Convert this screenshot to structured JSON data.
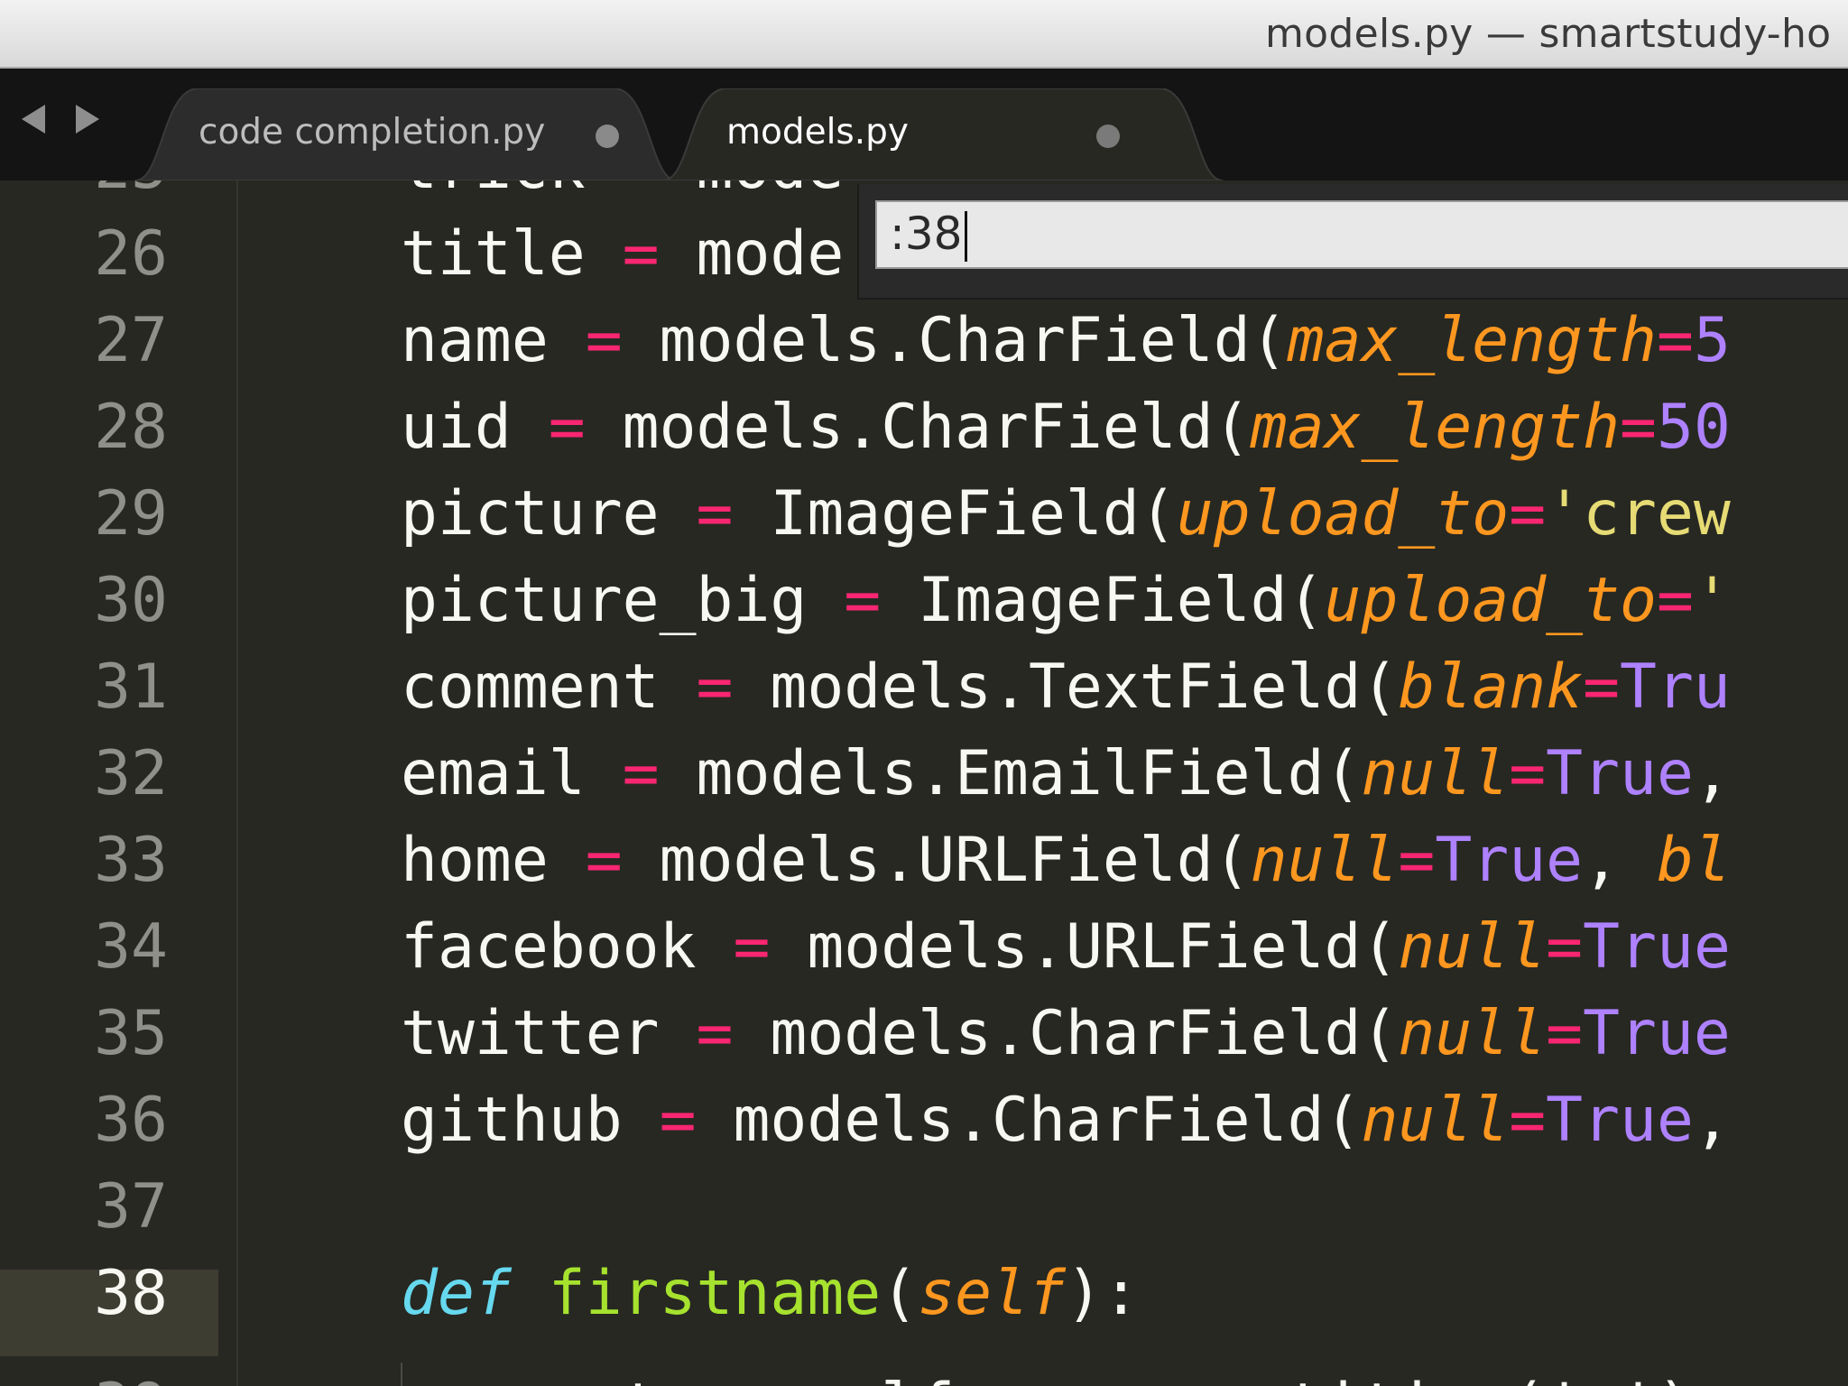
{
  "window": {
    "title": "models.py — smartstudy-ho"
  },
  "nav": {
    "back_icon": "chevron-left-icon",
    "forward_icon": "chevron-right-icon"
  },
  "tabs": [
    {
      "label": "code completion.py",
      "active": false,
      "modified": true
    },
    {
      "label": "models.py",
      "active": true,
      "modified": true
    }
  ],
  "goto": {
    "value": ":38"
  },
  "colors": {
    "background": "#272822",
    "operator": "#f92672",
    "argument": "#fd971f",
    "constant": "#ae81ff",
    "string": "#e6db74",
    "keyword": "#66d9ef",
    "function": "#a6e22e"
  },
  "editor": {
    "current_line": "38",
    "lines": [
      {
        "num": "26",
        "tokens": [
          {
            "t": "title ",
            "c": ""
          },
          {
            "t": "=",
            "c": "op"
          },
          {
            "t": " mode",
            "c": ""
          }
        ]
      },
      {
        "num": "27",
        "tokens": [
          {
            "t": "name ",
            "c": ""
          },
          {
            "t": "=",
            "c": "op"
          },
          {
            "t": " models.CharField(",
            "c": ""
          },
          {
            "t": "max_length",
            "c": "arg"
          },
          {
            "t": "=",
            "c": "op"
          },
          {
            "t": "5",
            "c": "num"
          }
        ]
      },
      {
        "num": "28",
        "tokens": [
          {
            "t": "uid ",
            "c": ""
          },
          {
            "t": "=",
            "c": "op"
          },
          {
            "t": " models.CharField(",
            "c": ""
          },
          {
            "t": "max_length",
            "c": "arg"
          },
          {
            "t": "=",
            "c": "op"
          },
          {
            "t": "50",
            "c": "num"
          }
        ]
      },
      {
        "num": "29",
        "tokens": [
          {
            "t": "picture ",
            "c": ""
          },
          {
            "t": "=",
            "c": "op"
          },
          {
            "t": " ImageField(",
            "c": ""
          },
          {
            "t": "upload_to",
            "c": "arg"
          },
          {
            "t": "=",
            "c": "op"
          },
          {
            "t": "'crew",
            "c": "str"
          }
        ]
      },
      {
        "num": "30",
        "tokens": [
          {
            "t": "picture_big ",
            "c": ""
          },
          {
            "t": "=",
            "c": "op"
          },
          {
            "t": " ImageField(",
            "c": ""
          },
          {
            "t": "upload_to",
            "c": "arg"
          },
          {
            "t": "=",
            "c": "op"
          },
          {
            "t": "'",
            "c": "str"
          }
        ]
      },
      {
        "num": "31",
        "tokens": [
          {
            "t": "comment ",
            "c": ""
          },
          {
            "t": "=",
            "c": "op"
          },
          {
            "t": " models.TextField(",
            "c": ""
          },
          {
            "t": "blank",
            "c": "arg"
          },
          {
            "t": "=",
            "c": "op"
          },
          {
            "t": "Tru",
            "c": "num"
          }
        ]
      },
      {
        "num": "32",
        "tokens": [
          {
            "t": "email ",
            "c": ""
          },
          {
            "t": "=",
            "c": "op"
          },
          {
            "t": " models.EmailField(",
            "c": ""
          },
          {
            "t": "null",
            "c": "arg"
          },
          {
            "t": "=",
            "c": "op"
          },
          {
            "t": "True",
            "c": "num"
          },
          {
            "t": ",",
            "c": ""
          }
        ]
      },
      {
        "num": "33",
        "tokens": [
          {
            "t": "home ",
            "c": ""
          },
          {
            "t": "=",
            "c": "op"
          },
          {
            "t": " models.URLField(",
            "c": ""
          },
          {
            "t": "null",
            "c": "arg"
          },
          {
            "t": "=",
            "c": "op"
          },
          {
            "t": "True",
            "c": "num"
          },
          {
            "t": ", ",
            "c": ""
          },
          {
            "t": "bl",
            "c": "arg"
          }
        ]
      },
      {
        "num": "34",
        "tokens": [
          {
            "t": "facebook ",
            "c": ""
          },
          {
            "t": "=",
            "c": "op"
          },
          {
            "t": " models.URLField(",
            "c": ""
          },
          {
            "t": "null",
            "c": "arg"
          },
          {
            "t": "=",
            "c": "op"
          },
          {
            "t": "True",
            "c": "num"
          }
        ]
      },
      {
        "num": "35",
        "tokens": [
          {
            "t": "twitter ",
            "c": ""
          },
          {
            "t": "=",
            "c": "op"
          },
          {
            "t": " models.CharField(",
            "c": ""
          },
          {
            "t": "null",
            "c": "arg"
          },
          {
            "t": "=",
            "c": "op"
          },
          {
            "t": "True",
            "c": "num"
          }
        ]
      },
      {
        "num": "36",
        "tokens": [
          {
            "t": "github ",
            "c": ""
          },
          {
            "t": "=",
            "c": "op"
          },
          {
            "t": " models.CharField(",
            "c": ""
          },
          {
            "t": "null",
            "c": "arg"
          },
          {
            "t": "=",
            "c": "op"
          },
          {
            "t": "True",
            "c": "num"
          },
          {
            "t": ",",
            "c": ""
          }
        ]
      },
      {
        "num": "37",
        "tokens": []
      },
      {
        "num": "38",
        "tokens": [
          {
            "t": "def",
            "c": "kw"
          },
          {
            "t": " ",
            "c": ""
          },
          {
            "t": "firstname",
            "c": "fn"
          },
          {
            "t": "(",
            "c": ""
          },
          {
            "t": "self",
            "c": "arg"
          },
          {
            "t": "):",
            "c": ""
          }
        ]
      }
    ]
  }
}
